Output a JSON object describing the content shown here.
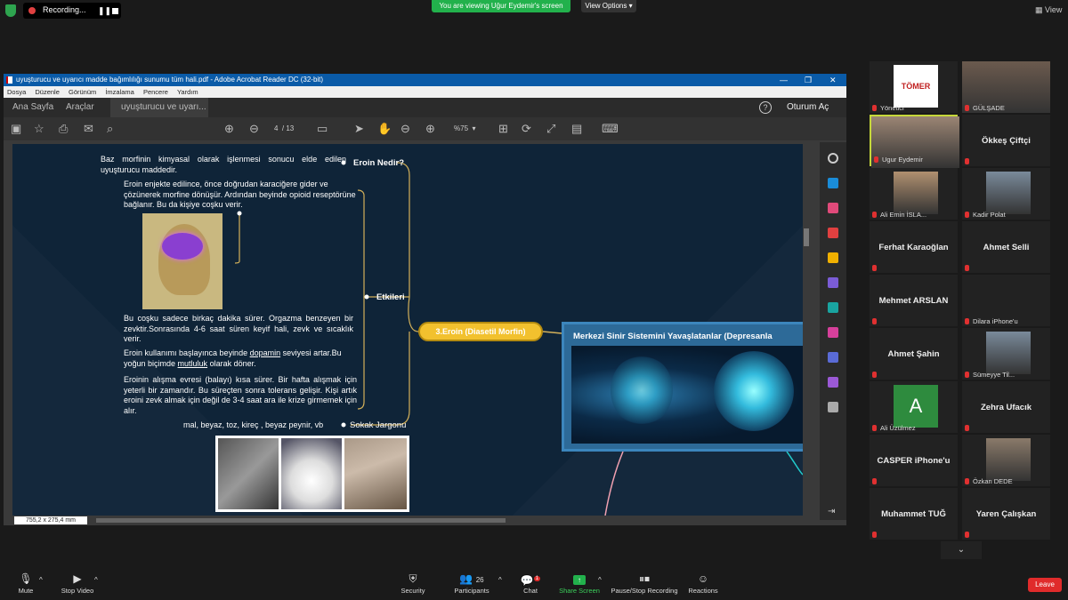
{
  "topbar": {
    "recording_label": "Recording...",
    "viewing_banner": "You are viewing Uğur Eydemir's screen",
    "view_options": "View Options",
    "view_button": "View"
  },
  "acrobat": {
    "title": "uyuşturucu ve uyarıcı madde bağımlılığı sunumu tüm hali.pdf - Adobe Acrobat Reader DC (32-bit)",
    "menu": [
      "Dosya",
      "Düzenle",
      "Görünüm",
      "İmzalama",
      "Pencere",
      "Yardım"
    ],
    "tab_home": "Ana Sayfa",
    "tab_tools": "Araçlar",
    "tab_doc": "uyuşturucu ve uyarı...",
    "login": "Oturum Aç",
    "page_current": "4",
    "page_total": "/ 13",
    "zoom": "%75",
    "dimensions": "755,2 x 275,4 mm"
  },
  "slide": {
    "n1_text": "Baz morfinin kimyasal olarak işlenmesi sonucu elde edilen uyuşturucu maddedir.",
    "n1_label": "Eroin Nedir?",
    "n2_text1": "Eroin enjekte edilince, önce doğrudan karaciğere gider ve çözünerek morfine dönüşür. Ardından beyinde opioid reseptörüne bağlanır. Bu da kişiye coşku verir.",
    "n2_text2": "Bu coşku sadece birkaç dakika sürer. Orgazma benzeyen bir zevktir.Sonrasında 4-6 saat süren keyif hali, zevk ve sıcaklık verir.",
    "n2_text3_a": "Eroin kullanımı başlayınca beyinde ",
    "n2_text3_u": "dopamin",
    "n2_text3_b": " seviyesi artar.Bu yoğun biçimde ",
    "n2_text3_u2": "mutluluk",
    "n2_text3_c": " olarak döner.",
    "n2_text4": "Eroinin alışma evresi (balayı) kısa sürer. Bir hafta alışmak için yeterli bir zamandır. Bu süreçten sonra tolerans gelişir. Kişi artık eroini zevk almak için değil de 3-4 saat ara ile krize girmemek için alır.",
    "n2_label": "Etkileri",
    "n3_text": "mal, beyaz, toz, kireç , beyaz peynir, vb",
    "n3_label": "Sokak Jargonu",
    "central": "3.Eroin (Diasetil Morfin)",
    "dep_title": "Merkezi Sinir Sistemini Yavaşlatanlar (Depresanla"
  },
  "participants": [
    {
      "name": "Yönetici",
      "logo": "TÖMER",
      "type": "logo"
    },
    {
      "name": "GÜLŞADE",
      "type": "photo"
    },
    {
      "name": "Ugur Eydemir",
      "type": "photo",
      "active": true
    },
    {
      "name": "Ökkeş Çiftçi",
      "type": "text"
    },
    {
      "name": "Ali Emin İSLA...",
      "type": "photo"
    },
    {
      "name": "Kadir Polat",
      "type": "photo"
    },
    {
      "name": "Ferhat Karaoğlan",
      "type": "text"
    },
    {
      "name": "Ahmet Selli",
      "type": "text"
    },
    {
      "name": "Mehmet ARSLAN",
      "type": "text"
    },
    {
      "name": "Dilara iPhone'u",
      "type": "blank"
    },
    {
      "name": "Ahmet Şahin",
      "type": "text"
    },
    {
      "name": "Sümeyye Til...",
      "type": "photo"
    },
    {
      "name": "Ali Üzülmez",
      "type": "avatar",
      "initial": "A"
    },
    {
      "name": "Zehra Ufacık",
      "type": "text"
    },
    {
      "name": "CASPER iPhone'u",
      "type": "text"
    },
    {
      "name": "Özkan DEDE",
      "type": "photo"
    },
    {
      "name": "Muhammet TUĞ",
      "type": "text"
    },
    {
      "name": "Yaren Çalışkan",
      "type": "text"
    }
  ],
  "toolbar": {
    "mute": "Mute",
    "stop_video": "Stop Video",
    "security": "Security",
    "participants": "Participants",
    "participants_count": "26",
    "chat": "Chat",
    "chat_badge": "1",
    "share_screen": "Share Screen",
    "pause_recording": "Pause/Stop Recording",
    "reactions": "Reactions",
    "leave": "Leave"
  },
  "colors": {
    "share_green": "#22b14c",
    "leave_red": "#e02b2b",
    "acrobat_blue": "#0a5ba8",
    "central_yellow": "#f2c12e"
  }
}
